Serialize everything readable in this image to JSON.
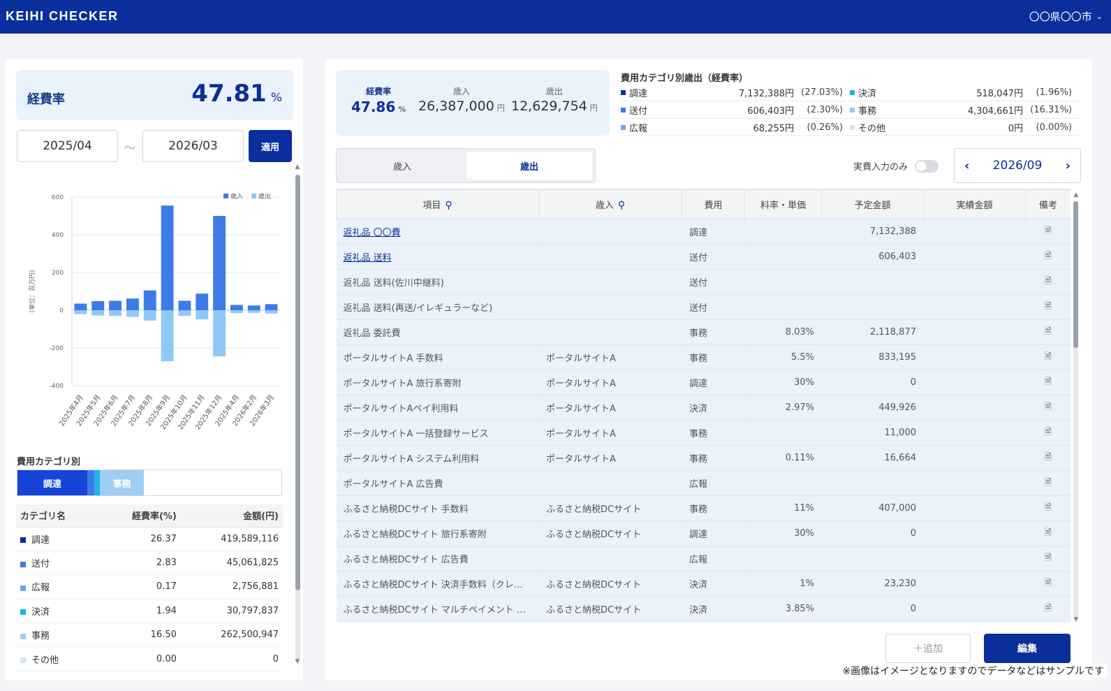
{
  "header": {
    "app_title": "KEIHI CHECKER",
    "city": "〇〇県〇〇市",
    "city_chevron": "chevron-down-icon"
  },
  "left": {
    "kpi": {
      "label": "経費率",
      "value": "47.81",
      "unit": "%"
    },
    "date_from": "2025/04",
    "tilde": "〜",
    "date_to": "2026/03",
    "apply_label": "適用",
    "category_title": "費用カテゴリ別",
    "category_bar": [
      {
        "name": "調達",
        "percent": 26.37,
        "color": "#1444d8",
        "label": "調達"
      },
      {
        "name": "送付",
        "percent": 2.83,
        "color": "#3d7be6",
        "label": ""
      },
      {
        "name": "広報",
        "percent": 0.17,
        "color": "#6aa6ee",
        "label": ""
      },
      {
        "name": "決済",
        "percent": 1.94,
        "color": "#15b8e6",
        "label": ""
      },
      {
        "name": "事務",
        "percent": 16.5,
        "color": "#9fcdf3",
        "label": "事務"
      },
      {
        "name": "その他",
        "percent": 0.0,
        "color": "#cfe6fa",
        "label": ""
      }
    ],
    "table": {
      "headers": [
        "カテゴリ名",
        "経費率(%)",
        "金額(円)"
      ],
      "rows": [
        {
          "name": "調達",
          "rate": "26.37",
          "amount": "419,589,116",
          "color": "#0a2e9c"
        },
        {
          "name": "送付",
          "rate": "2.83",
          "amount": "45,061,825",
          "color": "#3d7be6"
        },
        {
          "name": "広報",
          "rate": "0.17",
          "amount": "2,756,881",
          "color": "#6aa6ee"
        },
        {
          "name": "決済",
          "rate": "1.94",
          "amount": "30,797,837",
          "color": "#15b8e6"
        },
        {
          "name": "事務",
          "rate": "16.50",
          "amount": "262,500,947",
          "color": "#9fcdf3"
        },
        {
          "name": "その他",
          "rate": "0.00",
          "amount": "0",
          "color": "#cfe6fa"
        }
      ]
    }
  },
  "chart_data": {
    "type": "bar",
    "categories": [
      "2025年4月",
      "2025年5月",
      "2025年6月",
      "2025年7月",
      "2025年8月",
      "2025年9月",
      "2025年10月",
      "2025年11月",
      "2025年12月",
      "2025年4月",
      "2026年2月",
      "2026年3月"
    ],
    "series": [
      {
        "name": "歳入",
        "values": [
          35,
          48,
          50,
          62,
          105,
          555,
          50,
          88,
          500,
          28,
          25,
          32
        ],
        "color": "#3d7be6"
      },
      {
        "name": "歳出",
        "values": [
          -20,
          -28,
          -30,
          -35,
          -55,
          -270,
          -30,
          -48,
          -245,
          -15,
          -14,
          -18
        ],
        "color": "#8fc8f6"
      }
    ],
    "ylabel": "(単位：百万円)",
    "ylim": [
      -400,
      600
    ],
    "yticks": [
      600,
      400,
      200,
      0,
      -200,
      -400
    ],
    "grid": true,
    "legend": "top-right"
  },
  "right": {
    "summary": {
      "rate_label": "経費率",
      "rate_value": "47.86",
      "rate_unit": "%",
      "income_label": "歳入",
      "income_value": "26,387,000",
      "income_unit": "円",
      "expense_label": "歳出",
      "expense_value": "12,629,754",
      "expense_unit": "円"
    },
    "legend_title": "費用カテゴリ別歳出（経費率）",
    "legend": [
      {
        "name": "調達",
        "amount": "7,132,388円",
        "pct": "(27.03%)",
        "color": "#0a2e9c"
      },
      {
        "name": "決済",
        "amount": "518,047円",
        "pct": "(1.96%)",
        "color": "#15b8e6"
      },
      {
        "name": "送付",
        "amount": "606,403円",
        "pct": "(2.30%)",
        "color": "#3d7be6"
      },
      {
        "name": "事務",
        "amount": "4,304,661円",
        "pct": "(16.31%)",
        "color": "#8fc8f6"
      },
      {
        "name": "広報",
        "amount": "68,255円",
        "pct": "(0.26%)",
        "color": "#6aa6ee"
      },
      {
        "name": "その他",
        "amount": "0円",
        "pct": "(0.00%)",
        "color": "#cfe6fa"
      }
    ],
    "tabs": {
      "income": "歳入",
      "expense": "歳出"
    },
    "actual_only_label": "実費入力のみ",
    "month": "2026/09",
    "table_headers": [
      "項目",
      "歳入",
      "費用",
      "料率・単価",
      "予定金額",
      "実績金額",
      "備考"
    ],
    "rows": [
      {
        "item": "返礼品 〇〇費",
        "income": "",
        "cost": "調達",
        "rate": "",
        "planned": "7,132,388",
        "actual": "",
        "link": true
      },
      {
        "item": "返礼品 送料",
        "income": "",
        "cost": "送付",
        "rate": "",
        "planned": "606,403",
        "actual": "",
        "link": true
      },
      {
        "item": "返礼品 送料(佐川中継料)",
        "income": "",
        "cost": "送付",
        "rate": "",
        "planned": "",
        "actual": ""
      },
      {
        "item": "返礼品 送料(再送/イレギュラーなど)",
        "income": "",
        "cost": "送付",
        "rate": "",
        "planned": "",
        "actual": ""
      },
      {
        "item": "返礼品 委託費",
        "income": "",
        "cost": "事務",
        "rate": "8.03%",
        "planned": "2,118,877",
        "actual": ""
      },
      {
        "item": "ポータルサイトA 手数料",
        "income": "ポータルサイトA",
        "cost": "事務",
        "rate": "5.5%",
        "planned": "833,195",
        "actual": ""
      },
      {
        "item": "ポータルサイトA 旅行系寄附",
        "income": "ポータルサイトA",
        "cost": "調達",
        "rate": "30%",
        "planned": "0",
        "actual": ""
      },
      {
        "item": "ポータルサイトAペイ利用料",
        "income": "ポータルサイトA",
        "cost": "決済",
        "rate": "2.97%",
        "planned": "449,926",
        "actual": ""
      },
      {
        "item": "ポータルサイトA 一括登録サービス",
        "income": "ポータルサイトA",
        "cost": "事務",
        "rate": "",
        "planned": "11,000",
        "actual": ""
      },
      {
        "item": "ポータルサイトA システム利用料",
        "income": "ポータルサイトA",
        "cost": "事務",
        "rate": "0.11%",
        "planned": "16,664",
        "actual": ""
      },
      {
        "item": "ポータルサイトA 広告費",
        "income": "",
        "cost": "広報",
        "rate": "",
        "planned": "",
        "actual": ""
      },
      {
        "item": "ふるさと納税DCサイト 手数料",
        "income": "ふるさと納税DCサイト",
        "cost": "事務",
        "rate": "11%",
        "planned": "407,000",
        "actual": ""
      },
      {
        "item": "ふるさと納税DCサイト 旅行系寄附",
        "income": "ふるさと納税DCサイト",
        "cost": "調達",
        "rate": "30%",
        "planned": "0",
        "actual": ""
      },
      {
        "item": "ふるさと納税DCサイト 広告費",
        "income": "",
        "cost": "広報",
        "rate": "",
        "planned": "",
        "actual": ""
      },
      {
        "item": "ふるさと納税DCサイト 決済手数料（クレ…",
        "income": "ふるさと納税DCサイト",
        "cost": "決済",
        "rate": "1%",
        "planned": "23,230",
        "actual": ""
      },
      {
        "item": "ふるさと納税DCサイト マルチペイメント …",
        "income": "ふるさと納税DCサイト",
        "cost": "決済",
        "rate": "3.85%",
        "planned": "0",
        "actual": ""
      }
    ],
    "add_label": "＋追加",
    "edit_label": "編集"
  },
  "footnote": "※画像はイメージとなりますのでデータなどはサンプルです"
}
